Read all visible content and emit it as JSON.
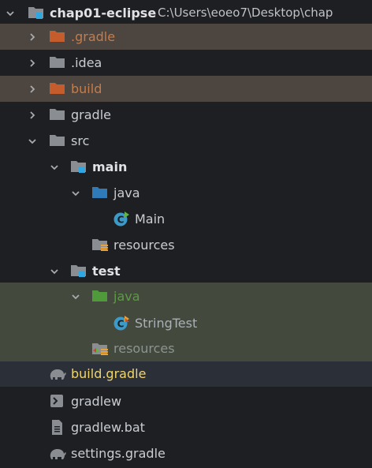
{
  "project": {
    "name": "chap01-eclipse",
    "path": "C:\\Users\\eoeo7\\Desktop\\chap"
  },
  "nodes": {
    "gradle_hidden": ".gradle",
    "idea": ".idea",
    "build": "build",
    "gradle": "gradle",
    "src": "src",
    "main": "main",
    "main_java": "java",
    "main_class": "Main",
    "main_resources": "resources",
    "test": "test",
    "test_java": "java",
    "test_class": "StringTest",
    "test_resources": "resources",
    "build_gradle": "build.gradle",
    "gradlew": "gradlew",
    "gradlew_bat": "gradlew.bat",
    "settings_gradle": "settings.gradle"
  },
  "colors": {
    "excluded_row_bg": "#4d4640",
    "test_row_bg": "#44493d",
    "selected_row_bg": "#2b2f38",
    "excluded_folder": "#c45d2b",
    "source_folder": "#2f7ab8",
    "test_folder": "#4f9a3a",
    "plain_folder": "#8a8d92",
    "module_badge": "#2fa7e0",
    "build_gradle_text": "#f0d56a"
  },
  "icons": {
    "expanded": "chevron-down-icon",
    "collapsed": "chevron-right-icon",
    "module": "module-folder-icon",
    "excluded": "excluded-folder-icon",
    "folder": "folder-icon",
    "source_root": "source-root-folder-icon",
    "test_root": "test-root-folder-icon",
    "resources": "resources-folder-icon",
    "test_resources": "test-resources-folder-icon",
    "java_class": "java-class-icon",
    "gradle": "gradle-elephant-icon",
    "shell": "shell-script-icon",
    "file": "text-file-icon"
  }
}
